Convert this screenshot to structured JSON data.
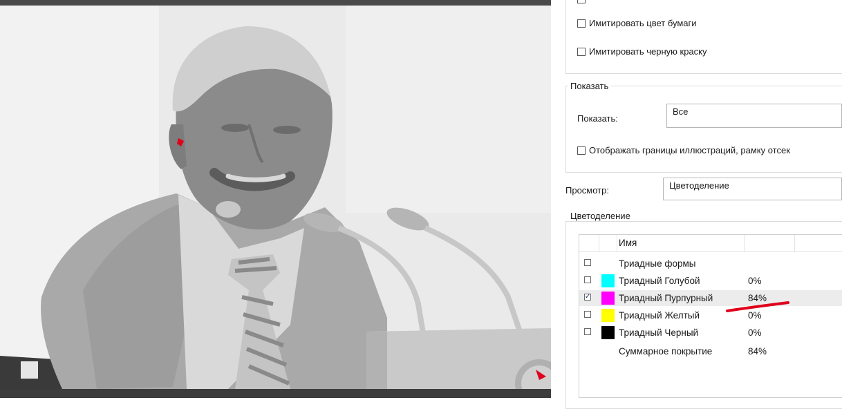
{
  "panel": {
    "simulate_paper_color": "Имитировать цвет бумаги",
    "simulate_black_ink": "Имитировать черную краску",
    "show_group_title": "Показать",
    "show_label": "Показать:",
    "show_value": "Все",
    "show_art_boundaries": "Отображать границы иллюстраций, рамку отсек",
    "preview_label": "Просмотр:",
    "preview_value": "Цветоделение",
    "separations_group_title": "Цветоделение"
  },
  "separations": {
    "header_name": "Имя",
    "rows": [
      {
        "checked": false,
        "name": "Триадные формы",
        "percent": "",
        "color": ""
      },
      {
        "checked": false,
        "name": "Триадный Голубой",
        "percent": "0%",
        "color": "#00ffff"
      },
      {
        "checked": true,
        "name": "Триадный Пурпурный",
        "percent": "84%",
        "color": "#ff00ff"
      },
      {
        "checked": false,
        "name": "Триадный Желтый",
        "percent": "0%",
        "color": "#ffff00"
      },
      {
        "checked": false,
        "name": "Триадный Черный",
        "percent": "0%",
        "color": "#000000"
      }
    ],
    "total_label": "Суммарное покрытие",
    "total_value": "84%"
  },
  "colors": {
    "annotation_red": "#e0001b",
    "selected_row": "#ececec"
  }
}
